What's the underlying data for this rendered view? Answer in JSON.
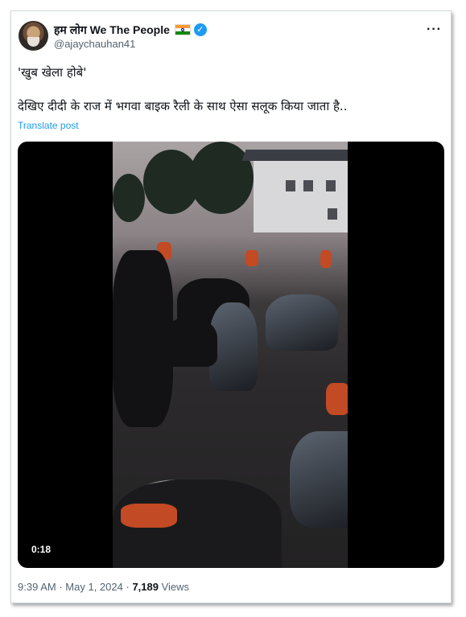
{
  "author": {
    "display_name": "हम लोग We The People",
    "handle": "@ajaychauhan41",
    "verified_icon": "check-icon",
    "flag_icon": "india-flag-icon",
    "accent_color": "#1d9bf0"
  },
  "tweet": {
    "line1": "'खुब खेला होबे'",
    "line2": "देखिए दीदी के राज में भगवा बाइक रैली के साथ ऐसा सलूक किया जाता है..",
    "translate_label": "Translate post"
  },
  "video": {
    "duration": "0:18"
  },
  "meta": {
    "time": "9:39 AM",
    "separator": "·",
    "date": "May 1, 2024",
    "views_count": "7,189",
    "views_label": "Views"
  },
  "more_icon": "more-horizontal-icon",
  "more_label": "···"
}
